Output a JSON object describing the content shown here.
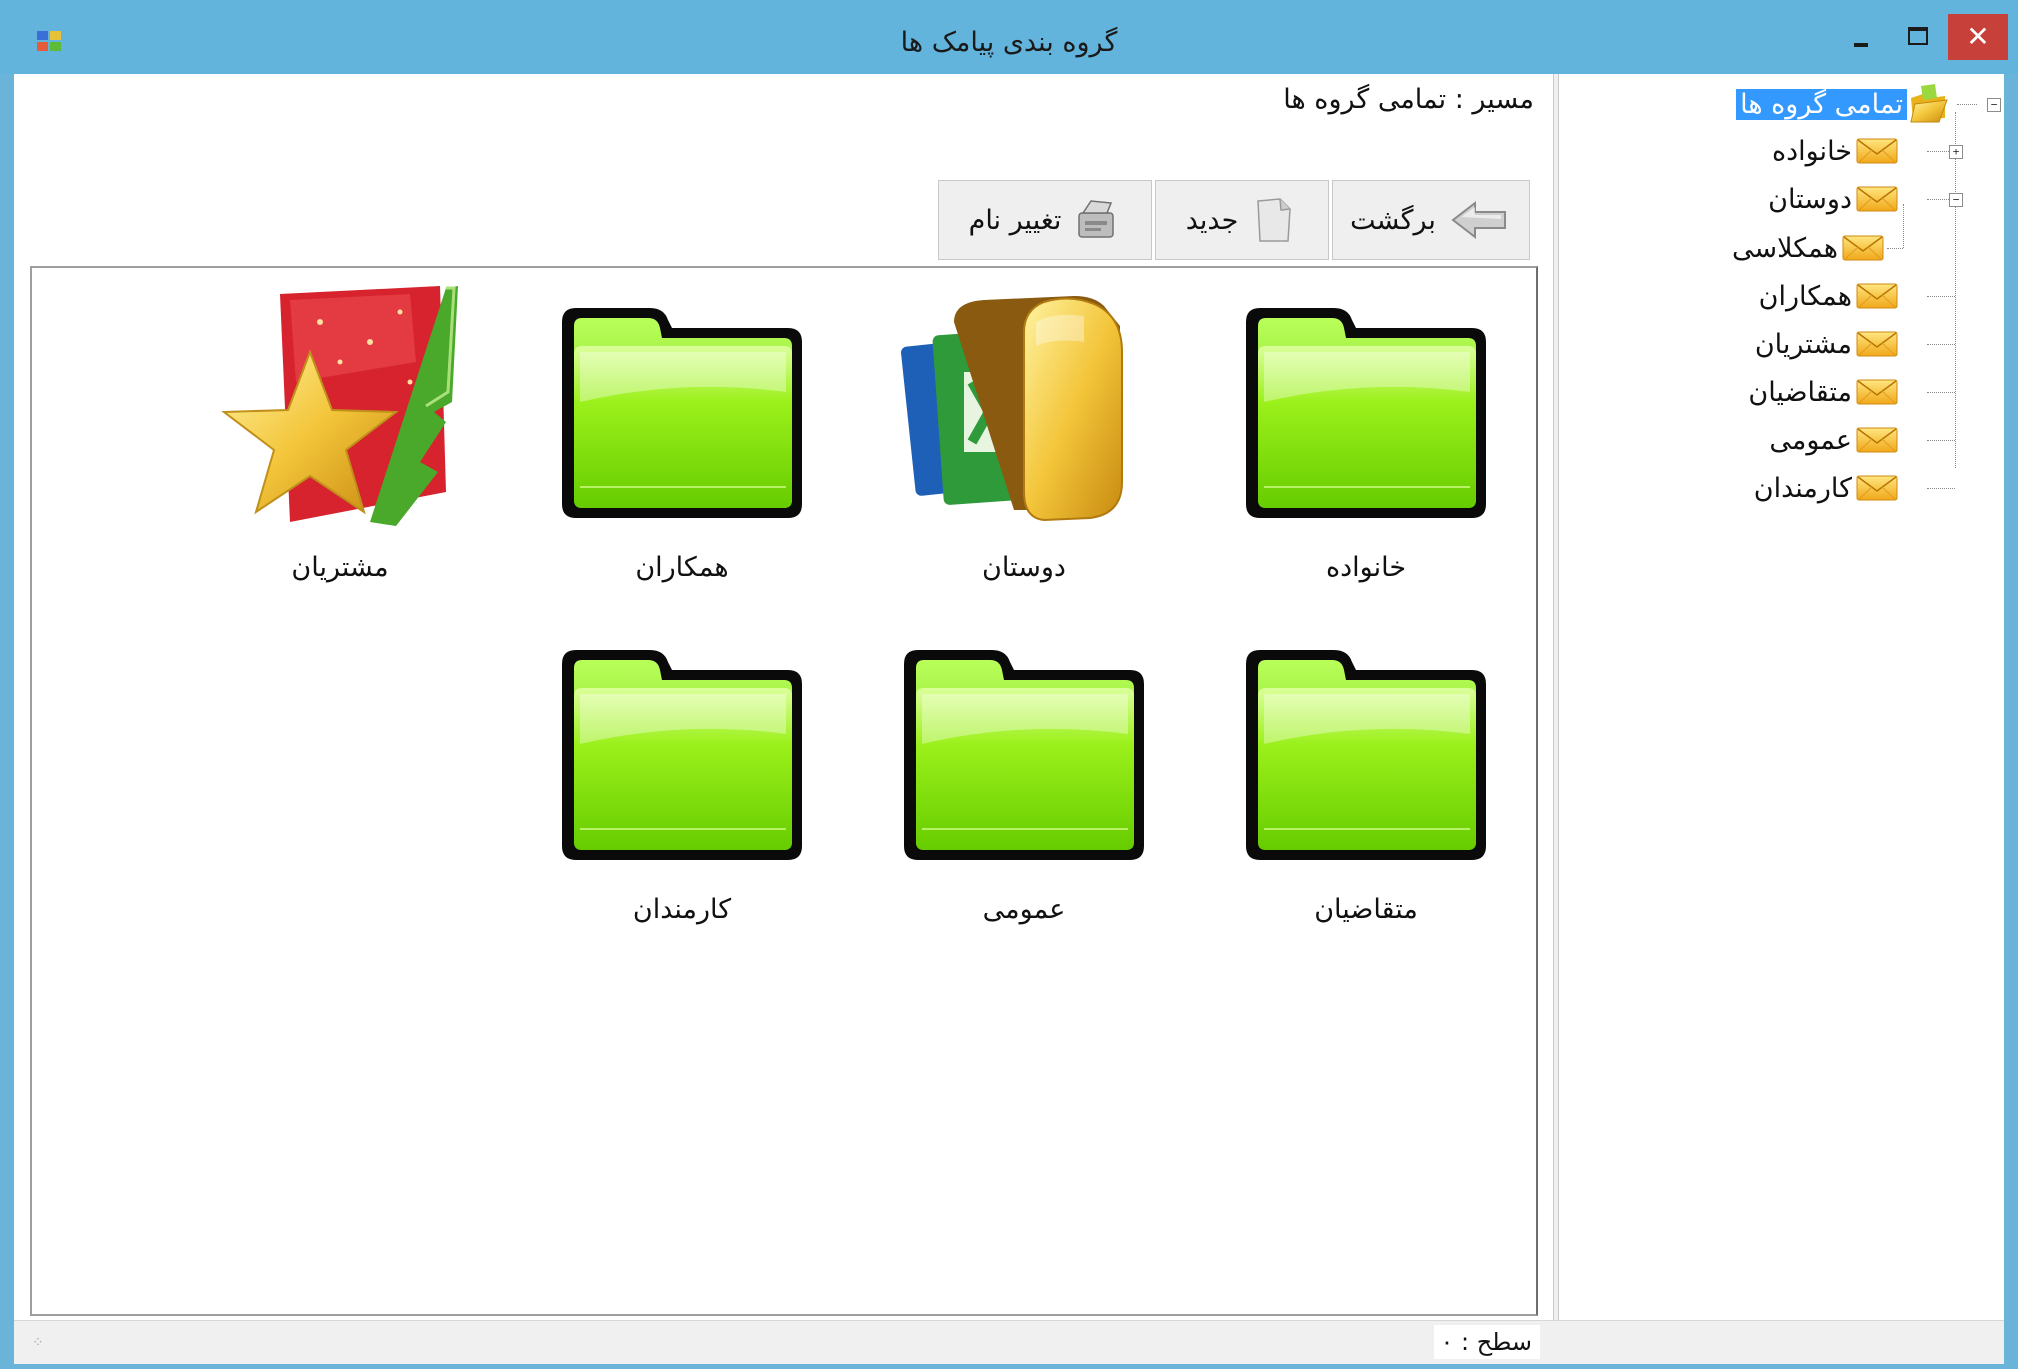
{
  "window": {
    "title": "گروه بندی پیامک ها",
    "close_glyph": "✕"
  },
  "path": {
    "label": "مسیر : تمامی گروه ها"
  },
  "toolbar": {
    "back_label": "برگشت",
    "new_label": "جدید",
    "rename_label": "تغییر نام"
  },
  "items": [
    {
      "label": "خانواده",
      "icon": "green-folder-icon"
    },
    {
      "label": "دوستان",
      "icon": "office-folder-icon"
    },
    {
      "label": "همکاران",
      "icon": "green-folder-icon"
    },
    {
      "label": "مشتریان",
      "icon": "star-folder-icon"
    },
    {
      "label": "متقاضیان",
      "icon": "green-folder-icon"
    },
    {
      "label": "عمومی",
      "icon": "green-folder-icon"
    },
    {
      "label": "کارمندان",
      "icon": "green-folder-icon"
    }
  ],
  "tree": {
    "root": "تمامی گروه ها",
    "nodes": [
      {
        "label": "خانواده",
        "expander": "+"
      },
      {
        "label": "دوستان",
        "expander": "−"
      },
      {
        "label": "همکلاسی",
        "expander": ""
      },
      {
        "label": "همکاران",
        "expander": ""
      },
      {
        "label": "مشتریان",
        "expander": ""
      },
      {
        "label": "متقاضیان",
        "expander": ""
      },
      {
        "label": "عمومی",
        "expander": ""
      },
      {
        "label": "کارمندان",
        "expander": ""
      }
    ],
    "root_expander": "−"
  },
  "status": {
    "level_label": "سطح : ۰"
  },
  "colors": {
    "titlebar": "#62b4dc",
    "selection": "#3399ff",
    "close": "#c7403a",
    "folder_green": "#7ee000"
  }
}
